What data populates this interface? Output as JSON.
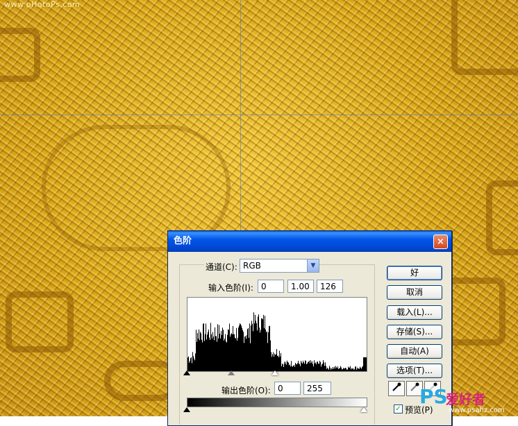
{
  "watermark_top": "www.pHotoPs.com",
  "dialog": {
    "title": "色阶",
    "close_label": "×",
    "channel_label": "通道(C):",
    "channel_value": "RGB",
    "input_label": "输入色阶(I):",
    "input_black": "0",
    "input_gamma": "1.00",
    "input_white": "126",
    "output_label": "输出色阶(O):",
    "output_black": "0",
    "output_white": "255",
    "buttons": {
      "ok": "好",
      "cancel": "取消",
      "load": "载入(L)...",
      "save": "存储(S)...",
      "auto": "自动(A)",
      "options": "选项(T)..."
    },
    "preview_label": "预览(P)",
    "preview_checked": true,
    "eyedroppers": [
      "black-eyedropper-icon",
      "gray-eyedropper-icon",
      "white-eyedropper-icon"
    ]
  },
  "logo": {
    "ps": "PS",
    "cn": "爱好者",
    "url": "www.psahz.com"
  }
}
